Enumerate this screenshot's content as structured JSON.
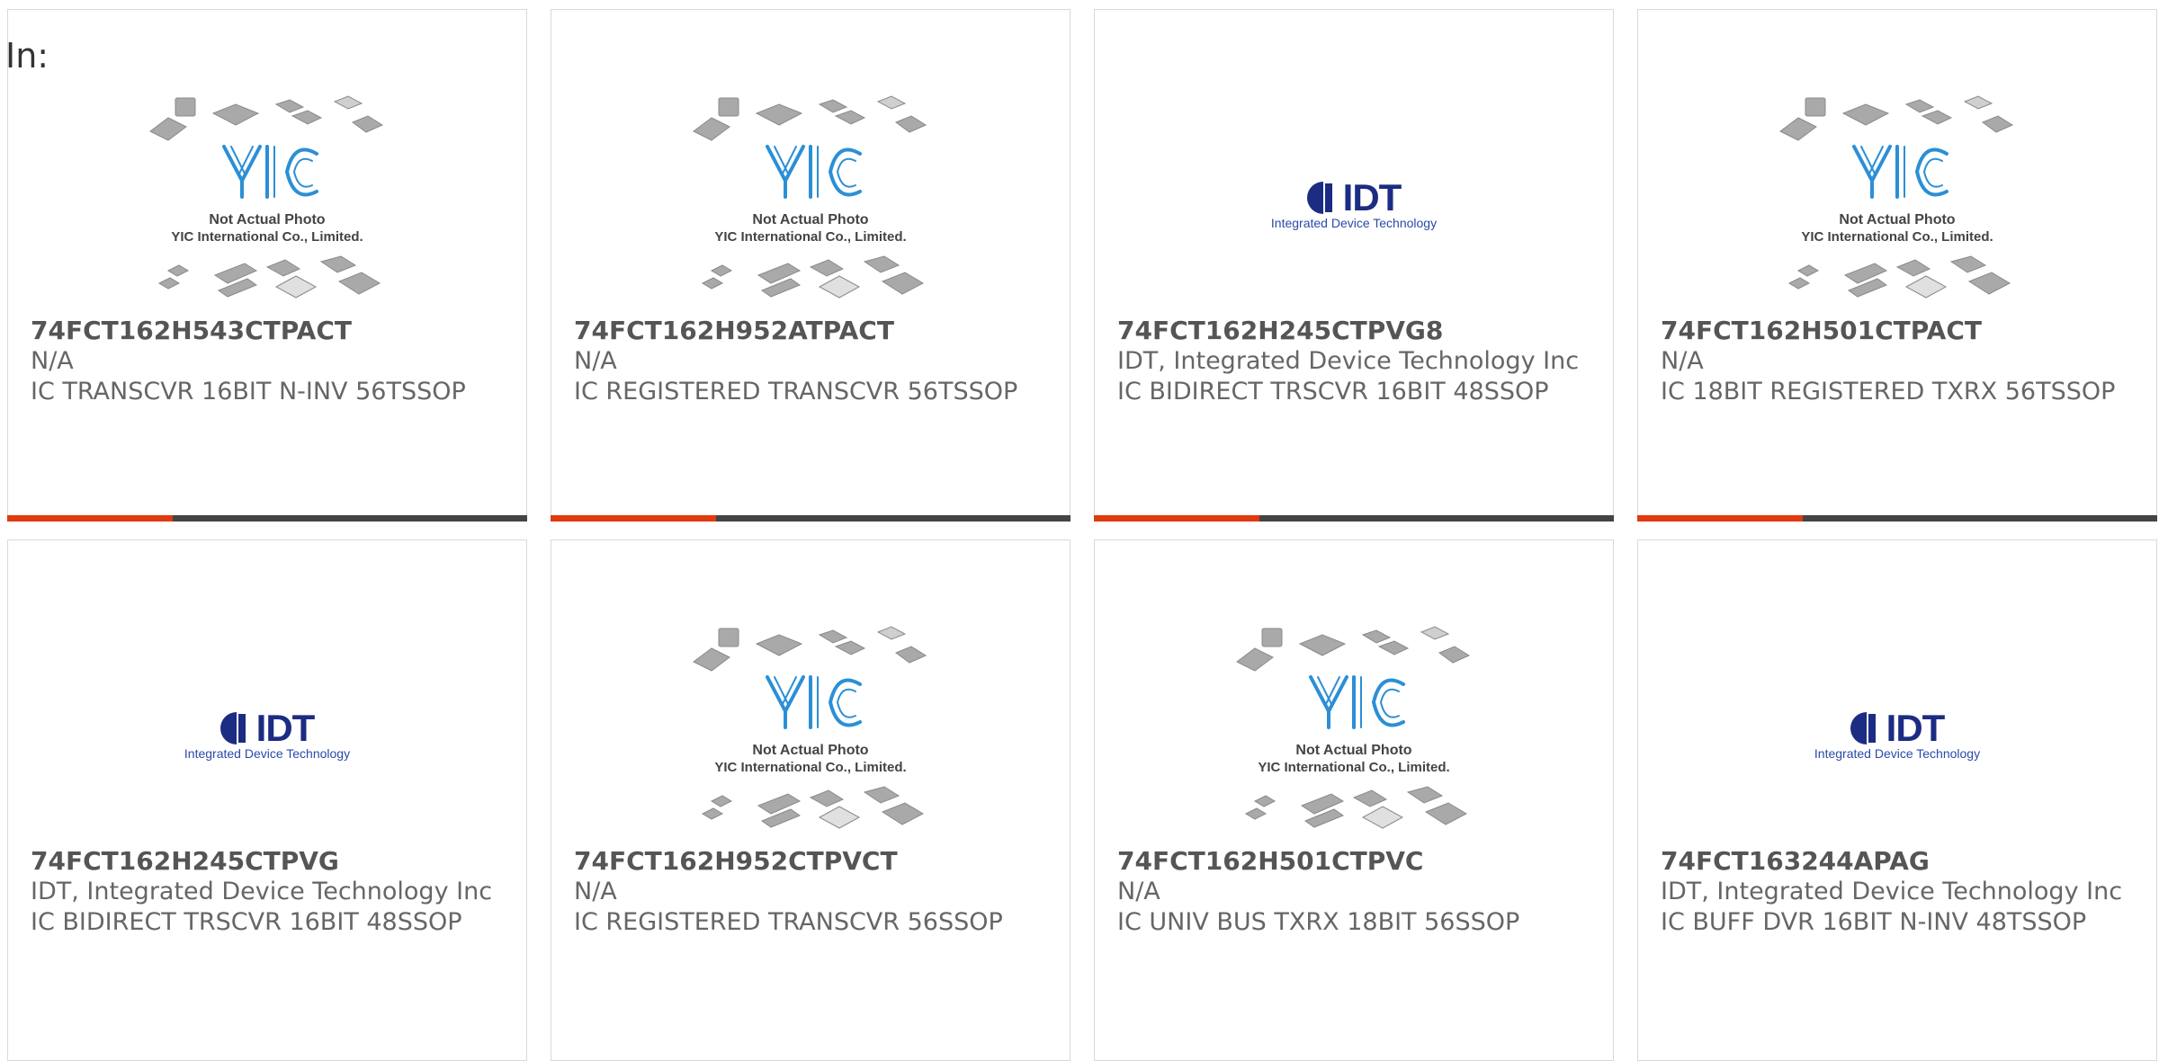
{
  "filter": {
    "label": "In:"
  },
  "placeholder_photo": {
    "brand": "YIC",
    "line1": "Not Actual Photo",
    "line2": "YIC International Co., Limited."
  },
  "idt_logo": {
    "mark": "IDT",
    "tagline": "Integrated Device Technology"
  },
  "colors": {
    "accent": "#e03a10",
    "bar_dark": "#444444",
    "yic_blue": "#2b8fd6",
    "idt_navy": "#1c2c83"
  },
  "products": [
    {
      "part_number": "74FCT162H543CTPACT",
      "manufacturer": "N/A",
      "description": "IC TRANSCVR 16BIT N-INV 56TSSOP",
      "image": "yic-placeholder"
    },
    {
      "part_number": "74FCT162H952ATPACT",
      "manufacturer": "N/A",
      "description": "IC REGISTERED TRANSCVR 56TSSOP",
      "image": "yic-placeholder"
    },
    {
      "part_number": "74FCT162H245CTPVG8",
      "manufacturer": "IDT, Integrated Device Technology Inc",
      "description": "IC BIDIRECT TRSCVR 16BIT 48SSOP",
      "image": "idt-logo"
    },
    {
      "part_number": "74FCT162H501CTPACT",
      "manufacturer": "N/A",
      "description": "IC 18BIT REGISTERED TXRX 56TSSOP",
      "image": "yic-placeholder"
    },
    {
      "part_number": "74FCT162H245CTPVG",
      "manufacturer": "IDT, Integrated Device Technology Inc",
      "description": "IC BIDIRECT TRSCVR 16BIT 48SSOP",
      "image": "idt-logo"
    },
    {
      "part_number": "74FCT162H952CTPVCT",
      "manufacturer": "N/A",
      "description": "IC REGISTERED TRANSCVR 56SSOP",
      "image": "yic-placeholder"
    },
    {
      "part_number": "74FCT162H501CTPVC",
      "manufacturer": "N/A",
      "description": "IC UNIV BUS TXRX 18BIT 56SSOP",
      "image": "yic-placeholder"
    },
    {
      "part_number": "74FCT163244APAG",
      "manufacturer": "IDT, Integrated Device Technology Inc",
      "description": "IC BUFF DVR 16BIT N-INV 48TSSOP",
      "image": "idt-logo"
    }
  ]
}
